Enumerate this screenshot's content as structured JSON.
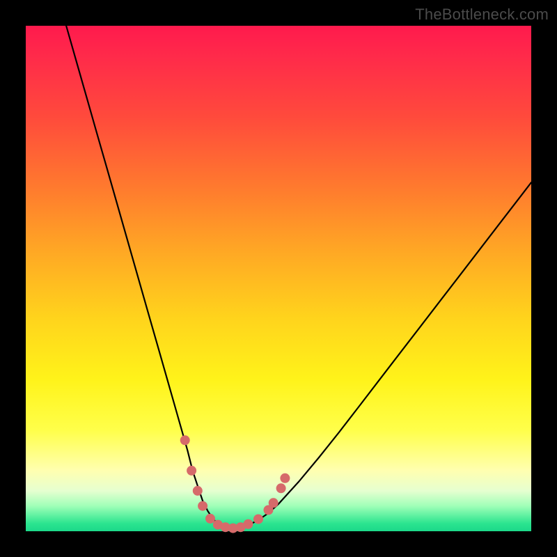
{
  "watermark": "TheBottleneck.com",
  "colors": {
    "marker": "#d66a6a",
    "curve": "#000000"
  },
  "chart_data": {
    "type": "line",
    "title": "",
    "xlabel": "",
    "ylabel": "",
    "xlim": [
      0,
      100
    ],
    "ylim": [
      0,
      100
    ],
    "gradient_axis": "y",
    "gradient_meaning": "red=high bottleneck, green=low bottleneck",
    "series": [
      {
        "name": "bottleneck-curve",
        "x": [
          8,
          10,
          12,
          14,
          16,
          18,
          20,
          22,
          24,
          26,
          28,
          30,
          32,
          33,
          34,
          35,
          36,
          37,
          38,
          39,
          40,
          41,
          42,
          44,
          46,
          48,
          50,
          54,
          58,
          62,
          66,
          70,
          74,
          78,
          82,
          86,
          90,
          94,
          98,
          100
        ],
        "y": [
          100,
          93,
          86,
          79,
          72,
          65,
          58,
          51,
          44,
          37,
          30,
          23,
          16,
          12,
          9,
          6,
          4,
          2.5,
          1.5,
          1.0,
          0.6,
          0.6,
          0.7,
          1.2,
          2.2,
          3.6,
          5.4,
          9.8,
          14.6,
          19.6,
          24.8,
          30.0,
          35.2,
          40.4,
          45.6,
          50.8,
          56.0,
          61.2,
          66.4,
          69.0
        ]
      }
    ],
    "markers": {
      "name": "highlighted-points",
      "color": "#d66a6a",
      "radius": 7,
      "points": [
        {
          "x": 31.5,
          "y": 18.0
        },
        {
          "x": 32.8,
          "y": 12.0
        },
        {
          "x": 34.0,
          "y": 8.0
        },
        {
          "x": 35.0,
          "y": 5.0
        },
        {
          "x": 36.5,
          "y": 2.5
        },
        {
          "x": 38.0,
          "y": 1.3
        },
        {
          "x": 39.5,
          "y": 0.8
        },
        {
          "x": 41.0,
          "y": 0.6
        },
        {
          "x": 42.5,
          "y": 0.8
        },
        {
          "x": 44.0,
          "y": 1.4
        },
        {
          "x": 46.0,
          "y": 2.4
        },
        {
          "x": 48.0,
          "y": 4.2
        },
        {
          "x": 49.0,
          "y": 5.6
        },
        {
          "x": 50.5,
          "y": 8.5
        },
        {
          "x": 51.3,
          "y": 10.5
        }
      ]
    }
  }
}
